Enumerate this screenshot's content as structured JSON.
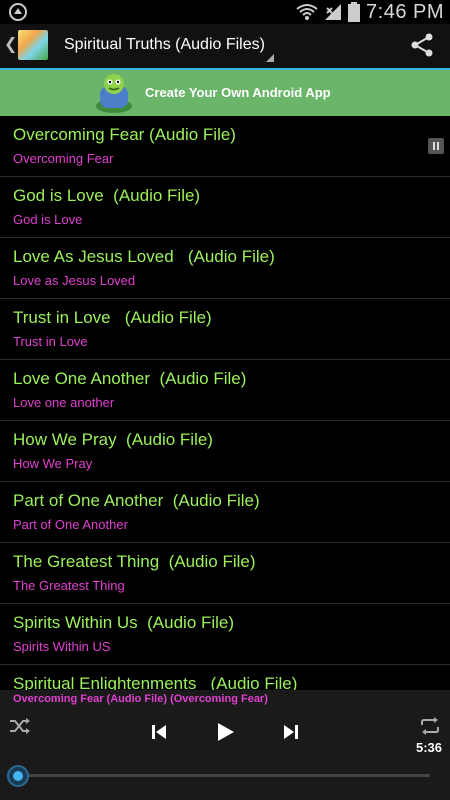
{
  "status_bar": {
    "time": "7:46 PM"
  },
  "action_bar": {
    "title": "Spiritual Truths (Audio Files)"
  },
  "banner": {
    "text": "Create Your Own Android App"
  },
  "list": {
    "items": [
      {
        "title": "Overcoming Fear (Audio File)",
        "subtitle": "Overcoming Fear",
        "playing": true
      },
      {
        "title": "God is Love  (Audio File)",
        "subtitle": "God is Love"
      },
      {
        "title": "Love As Jesus Loved   (Audio File)",
        "subtitle": "Love as Jesus Loved"
      },
      {
        "title": "Trust in Love   (Audio File)",
        "subtitle": "Trust in Love"
      },
      {
        "title": "Love One Another  (Audio File)",
        "subtitle": "Love one another"
      },
      {
        "title": "How We Pray  (Audio File)",
        "subtitle": "How We Pray"
      },
      {
        "title": "Part of One Another  (Audio File)",
        "subtitle": "Part of One Another"
      },
      {
        "title": "The Greatest Thing  (Audio File)",
        "subtitle": "The Greatest Thing"
      },
      {
        "title": "Spirits Within Us  (Audio File)",
        "subtitle": "Spirits Within US"
      },
      {
        "title": "Spiritual Enlightenments   (Audio File)",
        "subtitle": ""
      }
    ]
  },
  "player": {
    "now_playing": "Overcoming Fear (Audio File) (Overcoming Fear)",
    "time": "5:36",
    "progress": 0.0
  },
  "colors": {
    "title_green": "#9cf05a",
    "subtitle_magenta": "#e040d0",
    "accent_blue": "#33b5e5",
    "banner_green": "#6bb56b"
  }
}
